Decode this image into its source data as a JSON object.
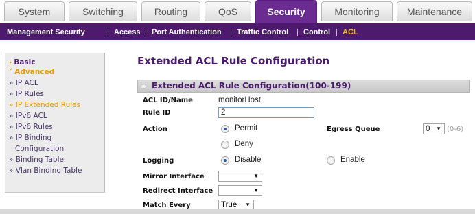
{
  "tabs": [
    {
      "label": "System",
      "active": false
    },
    {
      "label": "Switching",
      "active": false
    },
    {
      "label": "Routing",
      "active": false
    },
    {
      "label": "QoS",
      "active": false
    },
    {
      "label": "Security",
      "active": true
    },
    {
      "label": "Monitoring",
      "active": false
    },
    {
      "label": "Maintenance",
      "active": false
    }
  ],
  "subnav": [
    {
      "label": "Management Security",
      "active": false
    },
    {
      "label": "Access",
      "active": false
    },
    {
      "label": "Port Authentication",
      "active": false
    },
    {
      "label": "Traffic Control",
      "active": false
    },
    {
      "label": "Control",
      "active": false
    },
    {
      "label": "ACL",
      "active": true
    }
  ],
  "sidebar": {
    "basic": "Basic",
    "advanced": "Advanced",
    "marker": "»",
    "items": [
      {
        "label": "IP ACL",
        "active": false
      },
      {
        "label": "IP Rules",
        "active": false
      },
      {
        "label": "IP Extended Rules",
        "active": true
      },
      {
        "label": "IPv6 ACL",
        "active": false
      },
      {
        "label": "IPv6 Rules",
        "active": false
      },
      {
        "label": "IP Binding",
        "active": false
      },
      {
        "label": "Configuration",
        "active": false
      },
      {
        "label": "Binding Table",
        "active": false
      },
      {
        "label": "Vlan Binding Table",
        "active": false
      }
    ]
  },
  "main": {
    "title": "Extended ACL Rule Configuration",
    "section_title": "Extended ACL Rule Configuration(100-199)",
    "acl_id_label": "ACL ID/Name",
    "acl_id_value": "monitorHost",
    "rule_id_label": "Rule ID",
    "rule_id_value": "2",
    "action_label": "Action",
    "action_permit": "Permit",
    "action_deny": "Deny",
    "action_selected": "Permit",
    "egress_label": "Egress Queue",
    "egress_value": "0",
    "egress_hint": "(0-6)",
    "logging_label": "Logging",
    "logging_disable": "Disable",
    "logging_enable": "Enable",
    "logging_selected": "Disable",
    "mirror_label": "Mirror Interface",
    "mirror_value": "",
    "redirect_label": "Redirect Interface",
    "redirect_value": "",
    "match_every_label": "Match Every",
    "match_every_value": "True"
  },
  "colors": {
    "brand_purple": "#6a2c91",
    "subnav_bg": "#4d1a6e",
    "highlight": "#e59a00"
  }
}
